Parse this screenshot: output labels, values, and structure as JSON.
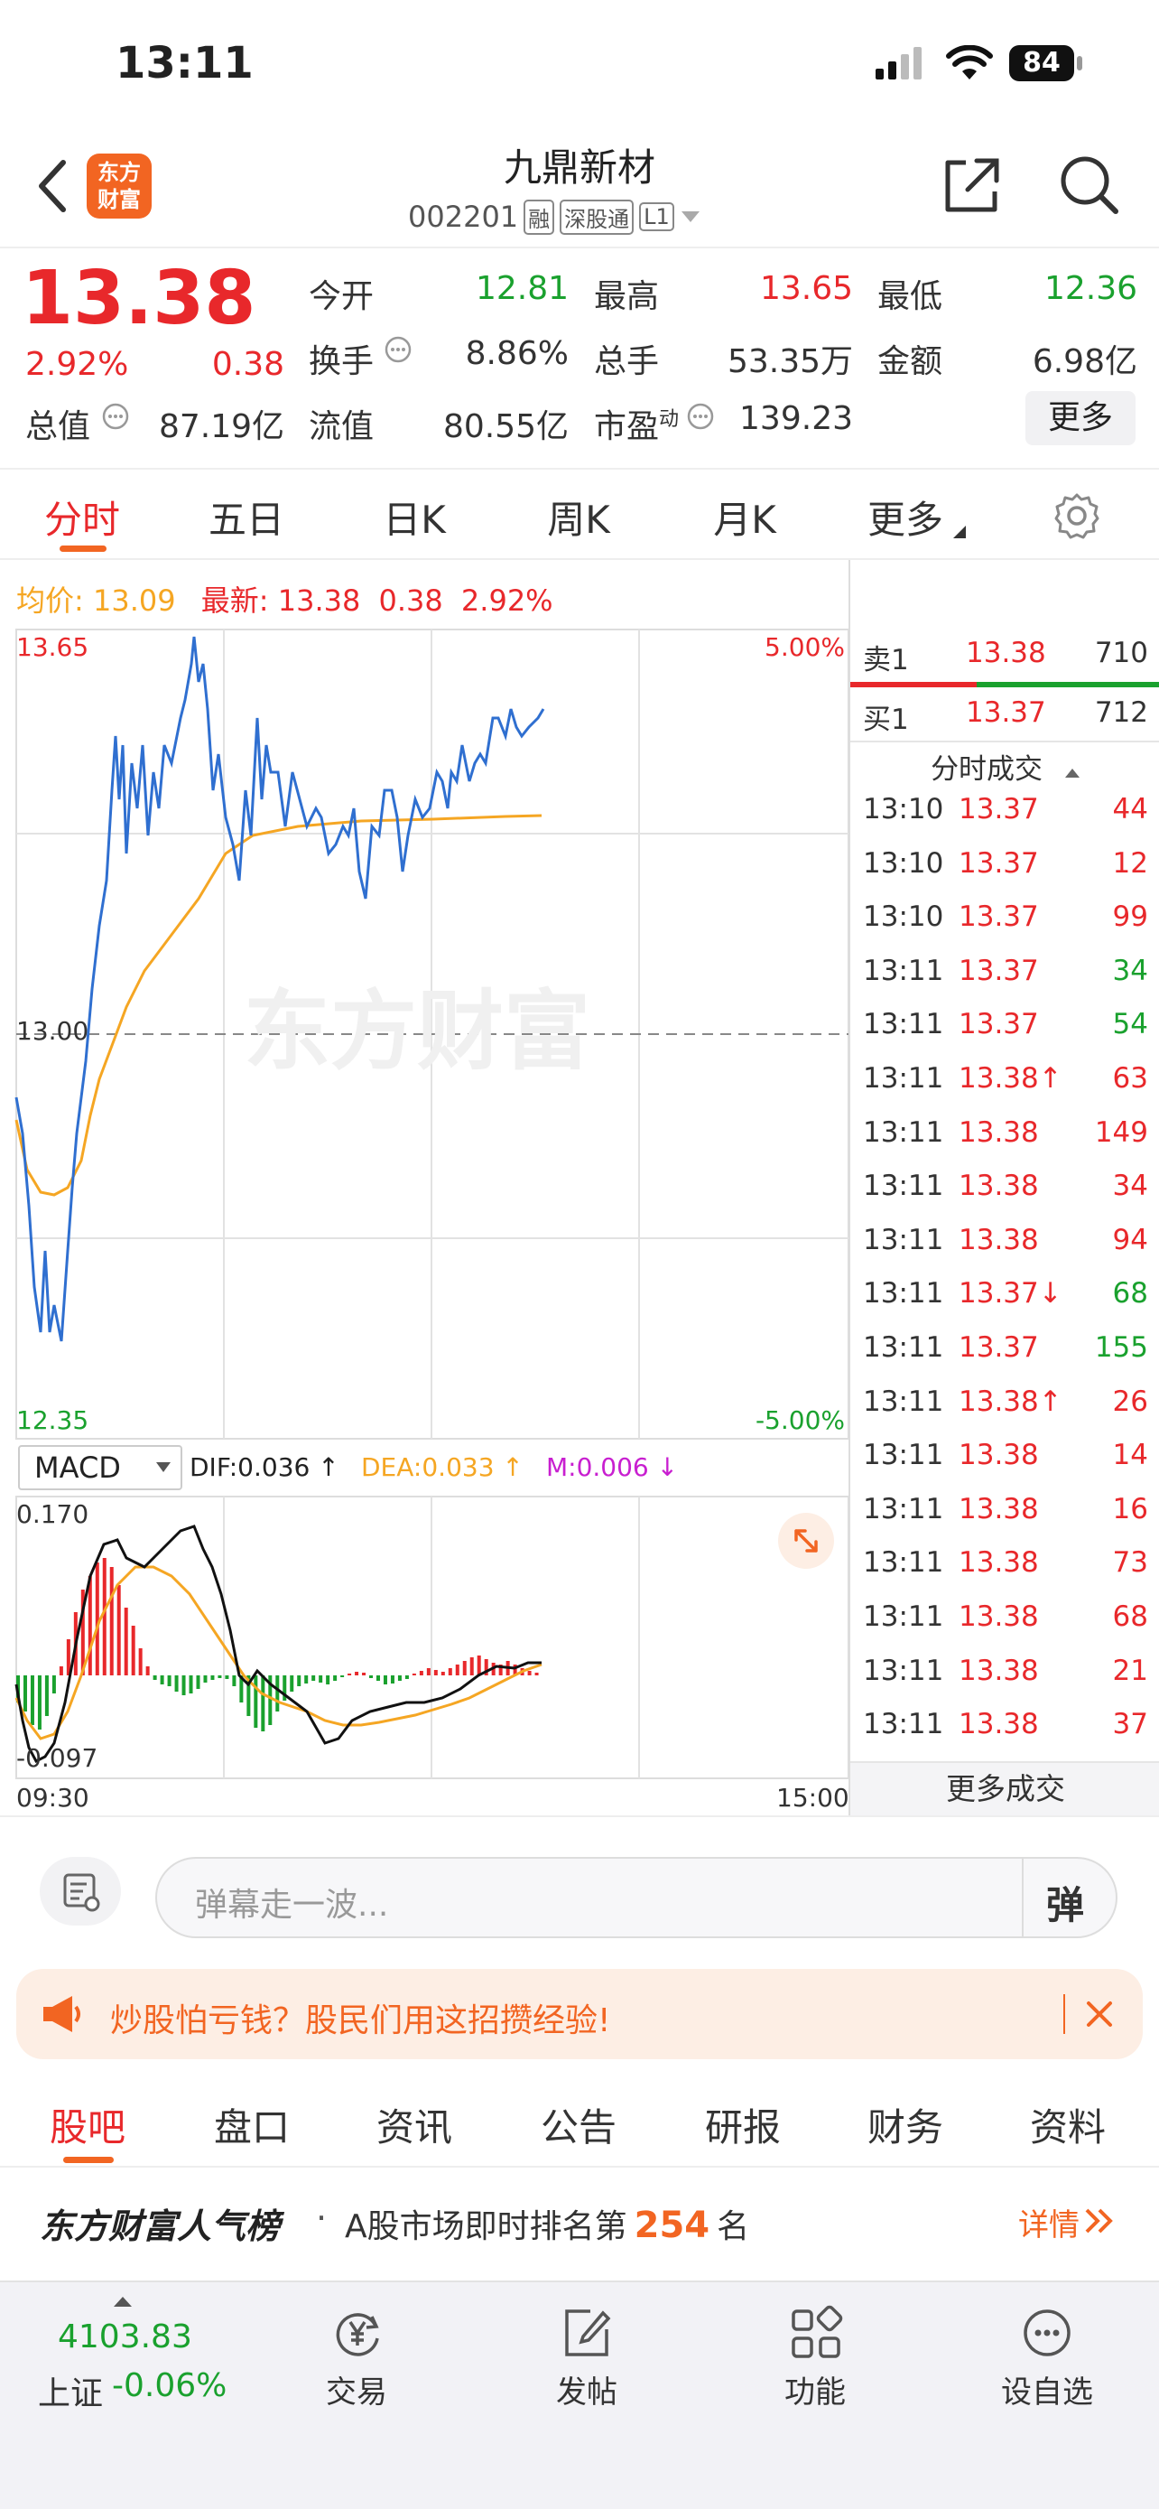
{
  "status_bar": {
    "time": "13:11",
    "battery": "84"
  },
  "header": {
    "logo_line1": "东方",
    "logo_line2": "财富",
    "title": "九鼎新材",
    "code": "002201",
    "tags": [
      "融",
      "深股通",
      "L1"
    ]
  },
  "quote": {
    "price": "13.38",
    "change_pct": "2.92%",
    "change": "0.38",
    "open_label": "今开",
    "open": "12.81",
    "high_label": "最高",
    "high": "13.65",
    "low_label": "最低",
    "low": "12.36",
    "turnover_label": "换手",
    "turnover": "8.86%",
    "volume_label": "总手",
    "volume": "53.35万",
    "amount_label": "金额",
    "amount": "6.98亿",
    "mktcap_label": "总值",
    "mktcap": "87.19亿",
    "float_label": "流值",
    "float": "80.55亿",
    "pe_label": "市盈",
    "pe_sup": "动",
    "pe": "139.23",
    "more_label": "更多"
  },
  "period_tabs": [
    {
      "label": "分时",
      "active": true
    },
    {
      "label": "五日"
    },
    {
      "label": "日K"
    },
    {
      "label": "周K"
    },
    {
      "label": "月K"
    },
    {
      "label": "更多"
    }
  ],
  "summary": {
    "avg_label": "均价:",
    "avg": "13.09",
    "latest_label": "最新:",
    "latest": "13.38",
    "chg": "0.38",
    "chg_pct": "2.92%"
  },
  "chart_axis": {
    "top": "13.65",
    "mid": "13.00",
    "bottom": "12.35",
    "top_pct": "5.00%",
    "bottom_pct": "-5.00%",
    "start_time": "09:30",
    "end_time": "15:00",
    "watermark": "东方财富"
  },
  "macd": {
    "selector": "MACD",
    "dif": "DIF:0.036 ↑",
    "dea": "DEA:0.033 ↑",
    "m": "M:0.006 ↓",
    "top": "0.170",
    "bottom": "-0.097"
  },
  "orderbook": {
    "sell_label": "卖1",
    "sell_price": "13.38",
    "sell_vol": "710",
    "buy_label": "买1",
    "buy_price": "13.37",
    "buy_vol": "712",
    "trades_title": "分时成交",
    "more_trades": "更多成交"
  },
  "trades": [
    {
      "time": "13:10",
      "price": "13.37",
      "vol": "44",
      "vc": "red"
    },
    {
      "time": "13:10",
      "price": "13.37",
      "vol": "12",
      "vc": "red"
    },
    {
      "time": "13:10",
      "price": "13.37",
      "vol": "99",
      "vc": "red"
    },
    {
      "time": "13:11",
      "price": "13.37",
      "vol": "34",
      "vc": "green"
    },
    {
      "time": "13:11",
      "price": "13.37",
      "vol": "54",
      "vc": "green"
    },
    {
      "time": "13:11",
      "price": "13.38↑",
      "vol": "63",
      "vc": "red"
    },
    {
      "time": "13:11",
      "price": "13.38",
      "vol": "149",
      "vc": "red"
    },
    {
      "time": "13:11",
      "price": "13.38",
      "vol": "34",
      "vc": "red"
    },
    {
      "time": "13:11",
      "price": "13.38",
      "vol": "94",
      "vc": "red"
    },
    {
      "time": "13:11",
      "price": "13.37↓",
      "vol": "68",
      "vc": "green"
    },
    {
      "time": "13:11",
      "price": "13.37",
      "vol": "155",
      "vc": "green"
    },
    {
      "time": "13:11",
      "price": "13.38↑",
      "vol": "26",
      "vc": "red"
    },
    {
      "time": "13:11",
      "price": "13.38",
      "vol": "14",
      "vc": "red"
    },
    {
      "time": "13:11",
      "price": "13.38",
      "vol": "16",
      "vc": "red"
    },
    {
      "time": "13:11",
      "price": "13.38",
      "vol": "73",
      "vc": "red"
    },
    {
      "time": "13:11",
      "price": "13.38",
      "vol": "68",
      "vc": "red"
    },
    {
      "time": "13:11",
      "price": "13.38",
      "vol": "21",
      "vc": "red"
    },
    {
      "time": "13:11",
      "price": "13.38",
      "vol": "37",
      "vc": "red"
    }
  ],
  "danmu": {
    "placeholder": "弹幕走一波...",
    "button": "弹"
  },
  "ad": {
    "text": "炒股怕亏钱？股民们用这招攒经验!"
  },
  "section_tabs": [
    {
      "label": "股吧",
      "active": true
    },
    {
      "label": "盘口"
    },
    {
      "label": "资讯"
    },
    {
      "label": "公告"
    },
    {
      "label": "研报"
    },
    {
      "label": "财务"
    },
    {
      "label": "资料"
    }
  ],
  "rank": {
    "title": "东方财富人气榜",
    "dot": "·",
    "text_pre": "A股市场即时排名第",
    "rank": "254",
    "text_post": "名",
    "detail": "详情"
  },
  "bottom_bar": {
    "index_value": "4103.83",
    "index_name": "上证",
    "index_chg": "-0.06%",
    "items": [
      {
        "label": "交易"
      },
      {
        "label": "发帖"
      },
      {
        "label": "功能"
      },
      {
        "label": "设自选"
      }
    ]
  }
}
